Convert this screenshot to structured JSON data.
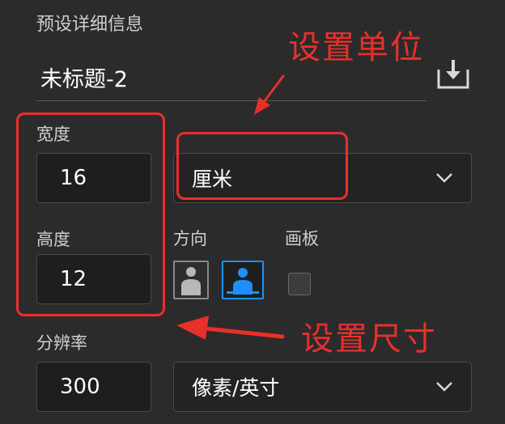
{
  "panel": {
    "section_title": "预设详细信息",
    "document_name": "未标题-2",
    "width_label": "宽度",
    "width_value": "16",
    "height_label": "高度",
    "height_value": "12",
    "unit_selected": "厘米",
    "orientation_label": "方向",
    "artboard_label": "画板",
    "artboard_checked": false,
    "resolution_label": "分辨率",
    "resolution_value": "300",
    "resolution_unit_selected": "像素/英寸",
    "orientation_selected": "landscape"
  },
  "annotations": {
    "set_unit": "设置单位",
    "set_size": "设置尺寸"
  },
  "colors": {
    "background": "#2b2b2b",
    "field_bg": "#1e1e1e",
    "accent_blue": "#1e8fff",
    "annotation_red": "#e8302a"
  },
  "icons": {
    "save_preset": "save-preset-icon",
    "dropdown": "chevron-down-icon",
    "portrait": "portrait-orientation-icon",
    "landscape": "landscape-orientation-icon"
  }
}
